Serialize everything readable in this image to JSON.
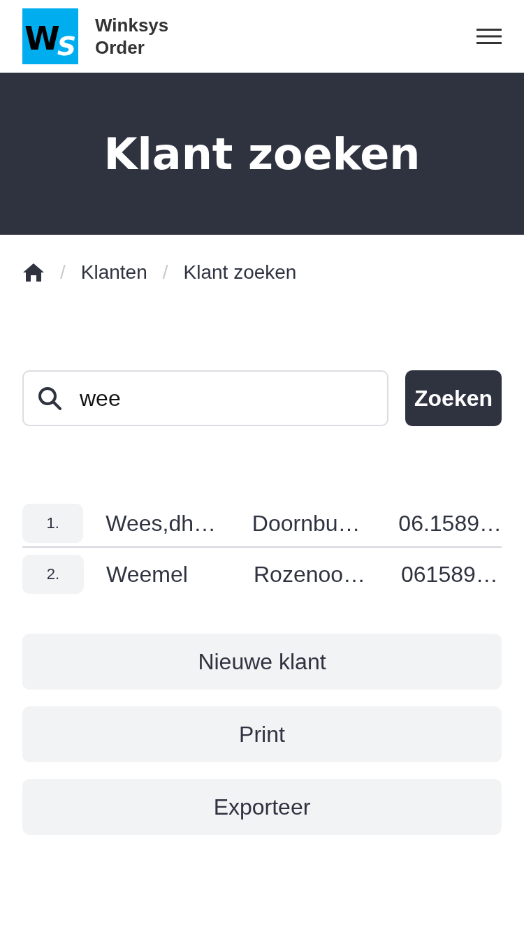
{
  "header": {
    "logo": {
      "first": "W",
      "second": "S"
    },
    "app_name": [
      "Winksys",
      "Order"
    ]
  },
  "hero": {
    "title": "Klant zoeken"
  },
  "breadcrumb": {
    "separator": "/",
    "items": [
      {
        "kind": "home"
      },
      {
        "kind": "link",
        "label": "Klanten"
      },
      {
        "kind": "current",
        "label": "Klant zoeken"
      }
    ]
  },
  "search": {
    "value": "wee",
    "button": "Zoeken"
  },
  "results": [
    {
      "number": "1.",
      "name": "Wees,dh…",
      "address": "Doornbu…",
      "phone": "06.1589…"
    },
    {
      "number": "2.",
      "name": "Weemel",
      "address": "Rozenoo…",
      "phone": "061589…"
    }
  ],
  "actions": [
    "Nieuwe klant",
    "Print",
    "Exporteer"
  ]
}
